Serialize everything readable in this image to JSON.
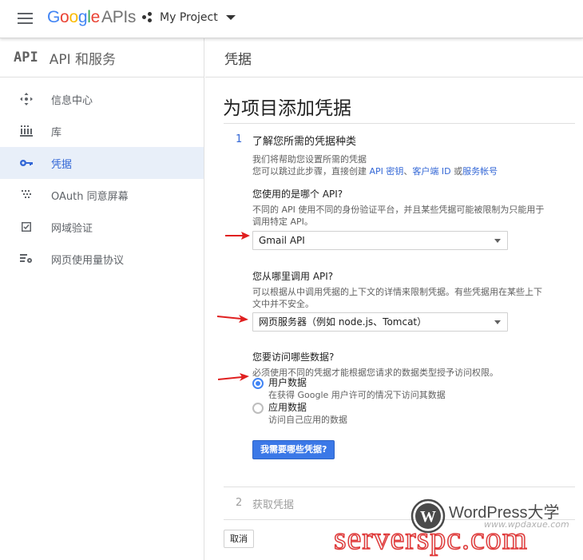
{
  "header": {
    "logo_google": "Google",
    "logo_apis": "APIs",
    "project_name": "My Project"
  },
  "sidebar": {
    "badge": "API",
    "title": "API 和服务",
    "items": [
      {
        "label": "信息中心",
        "icon": "dashboard-icon"
      },
      {
        "label": "库",
        "icon": "library-icon"
      },
      {
        "label": "凭据",
        "icon": "key-icon",
        "active": true
      },
      {
        "label": "OAuth 同意屏幕",
        "icon": "oauth-icon"
      },
      {
        "label": "网域验证",
        "icon": "domain-check-icon"
      },
      {
        "label": "网页使用量协议",
        "icon": "settings-list-icon"
      }
    ]
  },
  "main": {
    "header_title": "凭据",
    "page_title": "为项目添加凭据",
    "step1": {
      "number": "1",
      "title": "了解您所需的凭据种类",
      "lead_line1": "我们将帮助您设置所需的凭据",
      "lead_line2_prefix": "您可以跳过此步骤，直接创建 ",
      "link_api_key": "API 密钥",
      "sep1": "、",
      "link_client_id": "客户端 ID",
      "sep2": " 或",
      "link_service_account": "服务帐号"
    },
    "q1": {
      "question": "您使用的是哪个 API?",
      "desc": "不同的 API 使用不同的身份验证平台，并且某些凭据可能被限制为只能用于调用特定 API。",
      "selected": "Gmail API"
    },
    "q2": {
      "question": "您从哪里调用 API?",
      "desc": "可以根据从中调用凭据的上下文的详情来限制凭据。有些凭据用在某些上下文中并不安全。",
      "selected": "网页服务器（例如 node.js、Tomcat）"
    },
    "q3": {
      "question": "您要访问哪些数据?",
      "desc": "必须使用不同的凭据才能根据您请求的数据类型授予访问权限。",
      "options": [
        {
          "label": "用户数据",
          "sub": "在获得 Google 用户许可的情况下访问其数据",
          "checked": true
        },
        {
          "label": "应用数据",
          "sub": "访问自己应用的数据",
          "checked": false
        }
      ]
    },
    "primary_button": "我需要哪些凭据?",
    "step2": {
      "number": "2",
      "title": "获取凭据"
    },
    "cancel_button": "取消"
  },
  "watermark": {
    "brand": "WordPress大学",
    "url": "www.wpdaxue.com",
    "big_text": "serverspc.com"
  },
  "colors": {
    "accent": "#3367d6",
    "button_blue": "#3b78e7",
    "active_bg": "#e8eff9",
    "annotation_red": "#e02020"
  }
}
